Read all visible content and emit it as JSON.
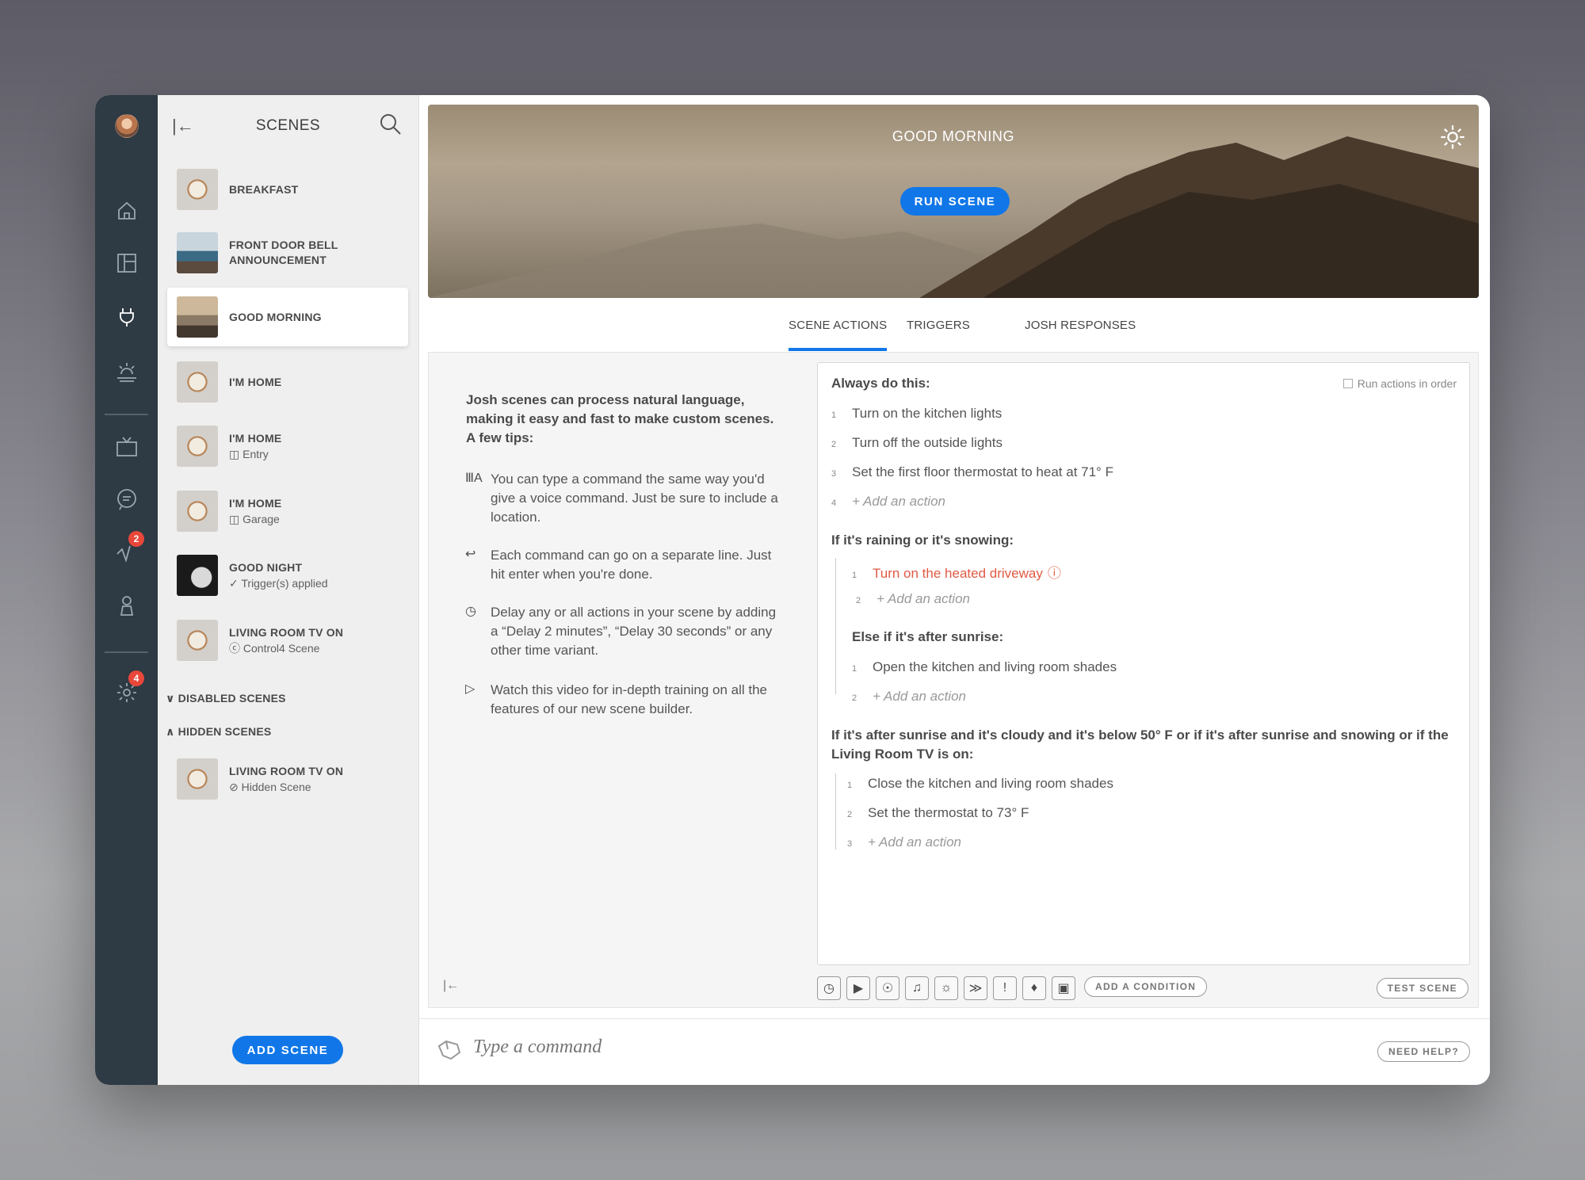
{
  "sidebar": {
    "badges": {
      "chart": "2",
      "settings": "4"
    }
  },
  "scenes": {
    "title": "SCENES",
    "items": [
      {
        "name": "BREAKFAST",
        "sub": ""
      },
      {
        "name": "FRONT DOOR BELL",
        "name2": "ANNOUNCEMENT",
        "sub": ""
      },
      {
        "name": "GOOD MORNING",
        "sub": ""
      },
      {
        "name": "I'M HOME",
        "sub": ""
      },
      {
        "name": "I'M HOME",
        "sub": "Entry"
      },
      {
        "name": "I'M HOME",
        "sub": "Garage"
      },
      {
        "name": "GOOD NIGHT",
        "sub": "Trigger(s) applied"
      },
      {
        "name": "LIVING ROOM TV ON",
        "sub": "Control4 Scene"
      }
    ],
    "disabled_label": "DISABLED SCENES",
    "hidden_label": "HIDDEN SCENES",
    "hidden_items": [
      {
        "name": "LIVING ROOM TV ON",
        "sub": "Hidden Scene"
      }
    ],
    "add_label": "ADD SCENE"
  },
  "hero": {
    "title": "GOOD MORNING",
    "run_label": "RUN SCENE"
  },
  "tabs": [
    "SCENE ACTIONS",
    "TRIGGERS",
    "JOSH RESPONSES"
  ],
  "tips": {
    "intro": "Josh scenes can process natural language, making it easy and fast to make custom scenes.",
    "few": "A few tips:",
    "items": [
      "You can type a command the same way you'd give a voice command. Just be sure to include a location.",
      "Each command can go on a separate line. Just hit enter when you're done.",
      "Delay any or all actions in your scene by adding a “Delay 2 minutes”, “Delay 30 seconds” or any other time variant.",
      "Watch this video for in-depth training on all the features of our new scene builder."
    ]
  },
  "editor": {
    "run_in_order": "Run actions in order",
    "always": "Always do this:",
    "always_items": [
      "Turn on the kitchen lights",
      "Turn off the outside lights",
      "Set the first floor thermostat to heat at 71° F"
    ],
    "add_action": "+ Add an action",
    "cond1": "If it's raining or it's snowing:",
    "cond1_items": [
      "Turn on the heated driveway"
    ],
    "else1": "Else if it's after sunrise:",
    "else1_items": [
      "Open the kitchen and living room shades"
    ],
    "cond2": "If it's after sunrise and it's cloudy and it's below 50° F or if it's after sunrise and snowing or if the Living Room TV is on:",
    "cond2_items": [
      "Close the kitchen and living room shades",
      "Set the thermostat to 73° F"
    ]
  },
  "toolbar": {
    "add_condition": "ADD A CONDITION",
    "test_scene": "TEST SCENE"
  },
  "command": {
    "placeholder": "Type a command",
    "help": "NEED HELP?"
  }
}
